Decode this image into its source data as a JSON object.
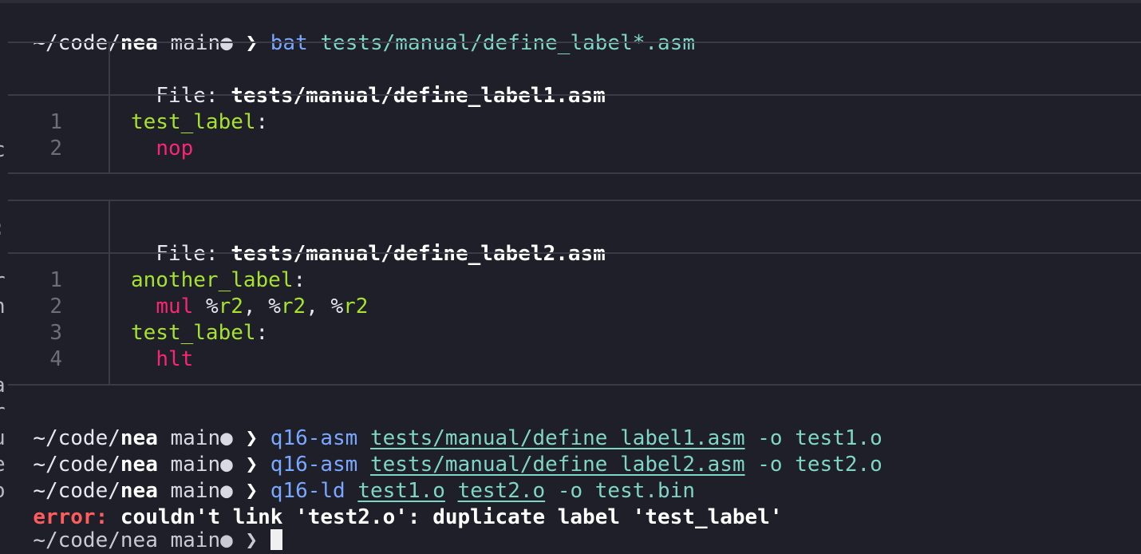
{
  "prompt": {
    "path_prefix": "~/code/",
    "dir": "nea",
    "branch": " main",
    "dot": "●",
    "arrow": " ❯ "
  },
  "commands": {
    "bat": {
      "cmd": "bat",
      "args": "tests/manual/define_label*.asm"
    },
    "asm1": {
      "cmd": "q16-asm",
      "file": "tests/manual/define_label1.asm",
      "flag": "-o",
      "out": "test1.o"
    },
    "asm2": {
      "cmd": "q16-asm",
      "file": "tests/manual/define_label2.asm",
      "flag": "-o",
      "out": "test2.o"
    },
    "ld": {
      "cmd": "q16-ld",
      "in1": "test1.o",
      "in2": "test2.o",
      "flag": "-o",
      "out": "test.bin"
    }
  },
  "files": [
    {
      "label": "File: ",
      "name": "tests/manual/define_label1.asm",
      "lines": [
        {
          "n": "1",
          "kw": "test_label",
          "colon": ":"
        },
        {
          "n": "2",
          "ins": "nop"
        }
      ]
    },
    {
      "label": "File: ",
      "name": "tests/manual/define_label2.asm",
      "lines": [
        {
          "n": "1",
          "kw": "another_label",
          "colon": ":"
        },
        {
          "n": "2",
          "ins": "mul",
          "ops": [
            "%",
            "r2",
            ", ",
            "%",
            "r2",
            ", ",
            "%",
            "r2"
          ]
        },
        {
          "n": "3",
          "kw": "test_label",
          "colon": ":"
        },
        {
          "n": "4",
          "ins": "hlt"
        }
      ]
    }
  ],
  "error": {
    "prefix": "error:",
    "message": " couldn't link 'test2.o': duplicate label 'test_label'"
  },
  "cut_prompt": "~/code/nea main● ❯ ",
  "left_edge_chars": [
    "c",
    ":",
    "|",
    "r",
    "n",
    "a",
    "r",
    "u",
    "e",
    "o"
  ]
}
